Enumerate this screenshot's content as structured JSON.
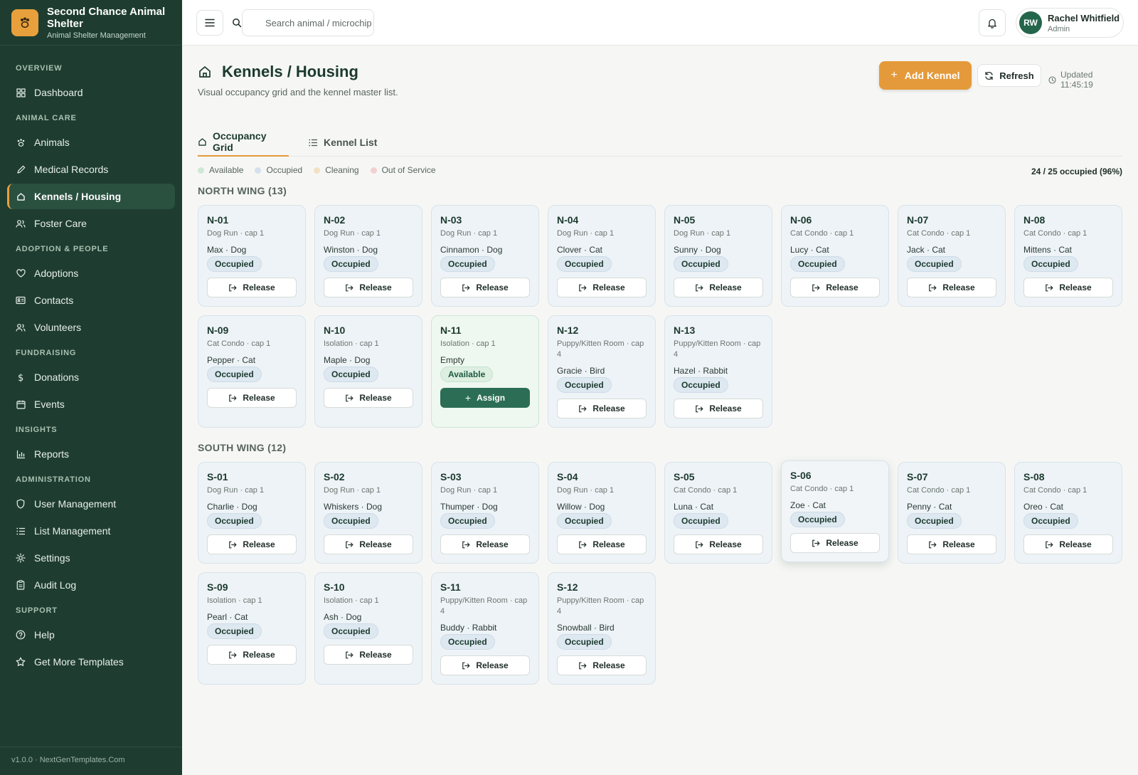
{
  "app": {
    "name": "Second Chance Animal Shelter",
    "subtitle": "Animal Shelter Management",
    "version": "v1.0.0 · NextGenTemplates.Com"
  },
  "sidebar": {
    "sections": [
      {
        "title": "Overview",
        "items": [
          {
            "label": "Dashboard",
            "icon": "dashboard-icon"
          }
        ]
      },
      {
        "title": "Animal Care",
        "items": [
          {
            "label": "Animals",
            "icon": "paw-icon"
          },
          {
            "label": "Medical Records",
            "icon": "pencil-icon"
          },
          {
            "label": "Kennels / Housing",
            "icon": "home-icon",
            "active": true
          },
          {
            "label": "Foster Care",
            "icon": "people-icon"
          }
        ]
      },
      {
        "title": "Adoption & People",
        "items": [
          {
            "label": "Adoptions",
            "icon": "heart-icon"
          },
          {
            "label": "Contacts",
            "icon": "contact-card-icon"
          },
          {
            "label": "Volunteers",
            "icon": "people-icon"
          }
        ]
      },
      {
        "title": "Fundraising",
        "items": [
          {
            "label": "Donations",
            "icon": "dollar-icon"
          },
          {
            "label": "Events",
            "icon": "calendar-icon"
          }
        ]
      },
      {
        "title": "Insights",
        "items": [
          {
            "label": "Reports",
            "icon": "bar-chart-icon"
          }
        ]
      },
      {
        "title": "Administration",
        "items": [
          {
            "label": "User Management",
            "icon": "shield-icon"
          },
          {
            "label": "List Management",
            "icon": "list-icon"
          },
          {
            "label": "Settings",
            "icon": "gear-icon"
          },
          {
            "label": "Audit Log",
            "icon": "clipboard-icon"
          }
        ]
      },
      {
        "title": "Support",
        "items": [
          {
            "label": "Help",
            "icon": "help-icon"
          },
          {
            "label": "Get More Templates",
            "icon": "star-icon"
          }
        ]
      }
    ]
  },
  "topbar": {
    "search_placeholder": "Search animal / microchip",
    "user": {
      "initials": "RW",
      "name": "Rachel Whitfield",
      "role": "Admin"
    }
  },
  "page": {
    "title": "Kennels / Housing",
    "subtitle": "Visual occupancy grid and the kennel master list.",
    "add_label": "Add Kennel",
    "refresh_label": "Refresh",
    "updated": "Updated 11:45:19"
  },
  "tabs": [
    {
      "label": "Occupancy Grid",
      "active": true
    },
    {
      "label": "Kennel List",
      "active": false
    }
  ],
  "legend": [
    {
      "label": "Available",
      "color": "#cfe8d6"
    },
    {
      "label": "Occupied",
      "color": "#d4e0ec"
    },
    {
      "label": "Cleaning",
      "color": "#f3e2c2"
    },
    {
      "label": "Out of Service",
      "color": "#f4d0d0"
    }
  ],
  "occupancy_summary": "24 / 25 occupied (96%)",
  "wings": [
    {
      "title": "NORTH WING (13)",
      "kennels": [
        {
          "id": "N-01",
          "type": "Dog Run · cap 1",
          "occupant": "Max · Dog",
          "status": "Occupied",
          "action": "Release"
        },
        {
          "id": "N-02",
          "type": "Dog Run · cap 1",
          "occupant": "Winston · Dog",
          "status": "Occupied",
          "action": "Release"
        },
        {
          "id": "N-03",
          "type": "Dog Run · cap 1",
          "occupant": "Cinnamon · Dog",
          "status": "Occupied",
          "action": "Release"
        },
        {
          "id": "N-04",
          "type": "Dog Run · cap 1",
          "occupant": "Clover · Cat",
          "status": "Occupied",
          "action": "Release"
        },
        {
          "id": "N-05",
          "type": "Dog Run · cap 1",
          "occupant": "Sunny · Dog",
          "status": "Occupied",
          "action": "Release"
        },
        {
          "id": "N-06",
          "type": "Cat Condo · cap 1",
          "occupant": "Lucy · Cat",
          "status": "Occupied",
          "action": "Release"
        },
        {
          "id": "N-07",
          "type": "Cat Condo · cap 1",
          "occupant": "Jack · Cat",
          "status": "Occupied",
          "action": "Release"
        },
        {
          "id": "N-08",
          "type": "Cat Condo · cap 1",
          "occupant": "Mittens · Cat",
          "status": "Occupied",
          "action": "Release"
        },
        {
          "id": "N-09",
          "type": "Cat Condo · cap 1",
          "occupant": "Pepper · Cat",
          "status": "Occupied",
          "action": "Release"
        },
        {
          "id": "N-10",
          "type": "Isolation · cap 1",
          "occupant": "Maple · Dog",
          "status": "Occupied",
          "action": "Release"
        },
        {
          "id": "N-11",
          "type": "Isolation · cap 1",
          "occupant": "Empty",
          "status": "Available",
          "action": "Assign"
        },
        {
          "id": "N-12",
          "type": "Puppy/Kitten Room · cap 4",
          "occupant": "Gracie · Bird",
          "status": "Occupied",
          "action": "Release"
        },
        {
          "id": "N-13",
          "type": "Puppy/Kitten Room · cap 4",
          "occupant": "Hazel · Rabbit",
          "status": "Occupied",
          "action": "Release"
        }
      ]
    },
    {
      "title": "SOUTH WING (12)",
      "kennels": [
        {
          "id": "S-01",
          "type": "Dog Run · cap 1",
          "occupant": "Charlie · Dog",
          "status": "Occupied",
          "action": "Release"
        },
        {
          "id": "S-02",
          "type": "Dog Run · cap 1",
          "occupant": "Whiskers · Dog",
          "status": "Occupied",
          "action": "Release"
        },
        {
          "id": "S-03",
          "type": "Dog Run · cap 1",
          "occupant": "Thumper · Dog",
          "status": "Occupied",
          "action": "Release"
        },
        {
          "id": "S-04",
          "type": "Dog Run · cap 1",
          "occupant": "Willow · Dog",
          "status": "Occupied",
          "action": "Release"
        },
        {
          "id": "S-05",
          "type": "Cat Condo · cap 1",
          "occupant": "Luna · Cat",
          "status": "Occupied",
          "action": "Release"
        },
        {
          "id": "S-06",
          "type": "Cat Condo · cap 1",
          "occupant": "Zoe · Cat",
          "status": "Occupied",
          "action": "Release",
          "hovered": true
        },
        {
          "id": "S-07",
          "type": "Cat Condo · cap 1",
          "occupant": "Penny · Cat",
          "status": "Occupied",
          "action": "Release"
        },
        {
          "id": "S-08",
          "type": "Cat Condo · cap 1",
          "occupant": "Oreo · Cat",
          "status": "Occupied",
          "action": "Release"
        },
        {
          "id": "S-09",
          "type": "Isolation · cap 1",
          "occupant": "Pearl · Cat",
          "status": "Occupied",
          "action": "Release"
        },
        {
          "id": "S-10",
          "type": "Isolation · cap 1",
          "occupant": "Ash · Dog",
          "status": "Occupied",
          "action": "Release"
        },
        {
          "id": "S-11",
          "type": "Puppy/Kitten Room · cap 4",
          "occupant": "Buddy · Rabbit",
          "status": "Occupied",
          "action": "Release"
        },
        {
          "id": "S-12",
          "type": "Puppy/Kitten Room · cap 4",
          "occupant": "Snowball · Bird",
          "status": "Occupied",
          "action": "Release"
        }
      ]
    }
  ]
}
